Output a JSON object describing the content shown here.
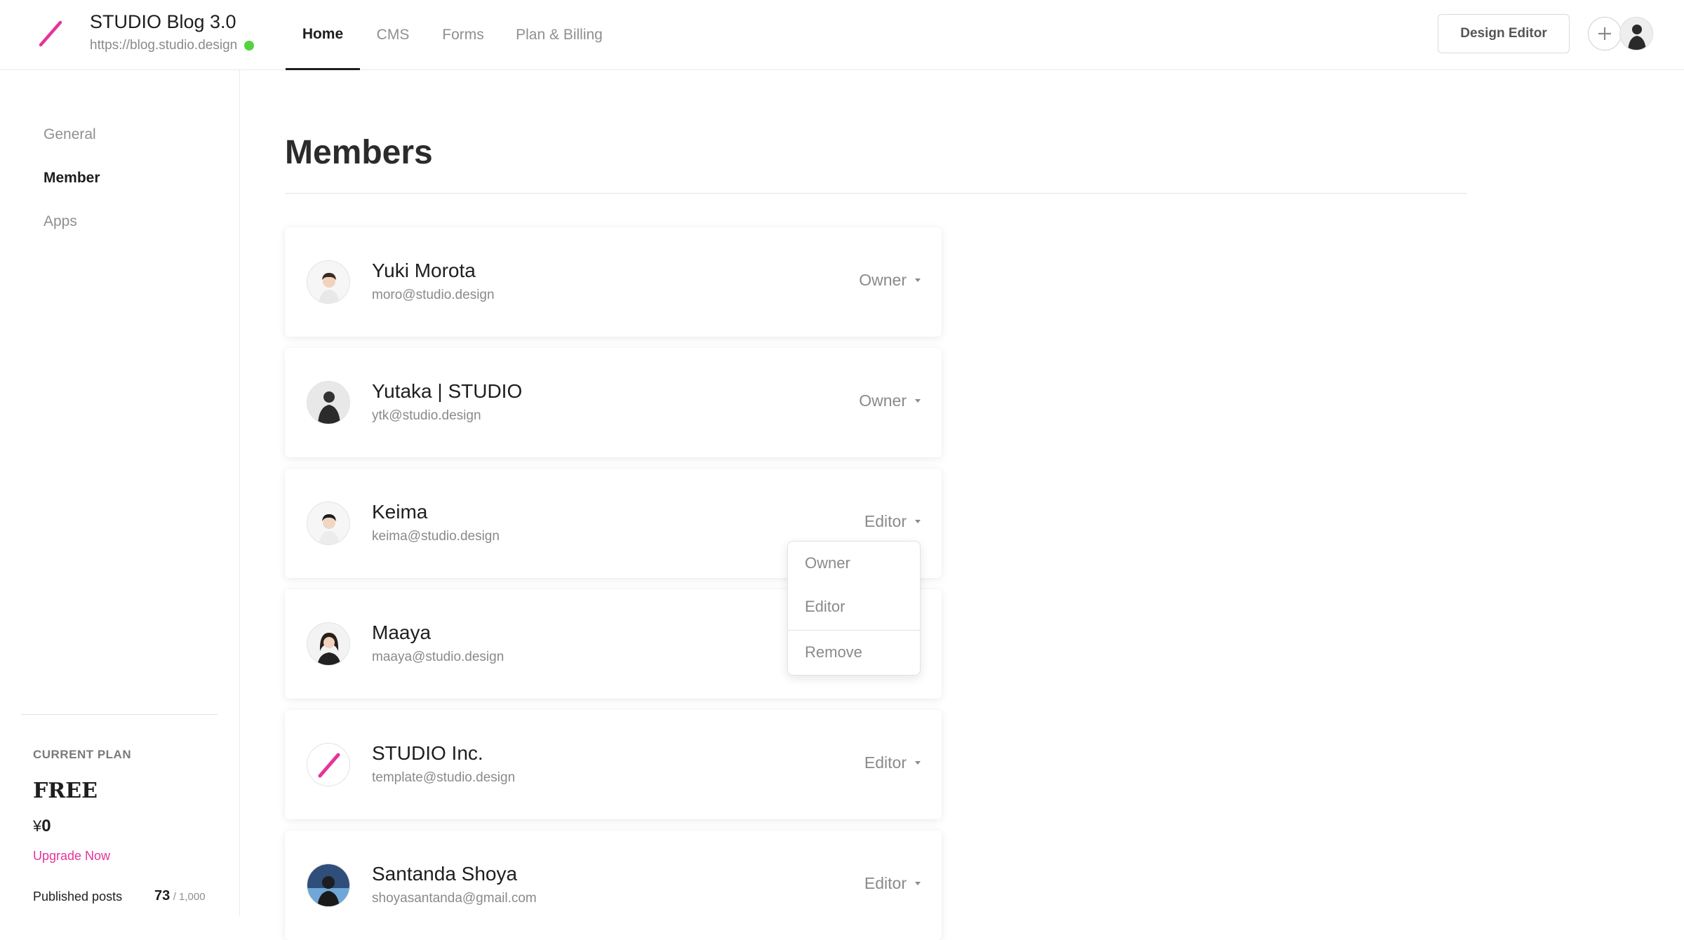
{
  "site": {
    "title": "STUDIO Blog 3.0",
    "url": "https://blog.studio.design",
    "status_color": "#54d33c",
    "brand_color": "#e6339a"
  },
  "nav": {
    "tabs": [
      {
        "label": "Home",
        "active": true
      },
      {
        "label": "CMS",
        "active": false
      },
      {
        "label": "Forms",
        "active": false
      },
      {
        "label": "Plan & Billing",
        "active": false
      }
    ]
  },
  "header": {
    "design_editor_label": "Design Editor",
    "add_icon": "plus-icon"
  },
  "sidebar": {
    "items": [
      {
        "label": "General",
        "active": false
      },
      {
        "label": "Member",
        "active": true
      },
      {
        "label": "Apps",
        "active": false
      }
    ],
    "plan": {
      "label": "CURRENT PLAN",
      "name": "FREE",
      "currency": "¥",
      "price": "0",
      "upgrade_label": "Upgrade Now"
    },
    "posts": {
      "label": "Published posts",
      "count": "73",
      "limit": "/ 1,000"
    }
  },
  "main": {
    "title": "Members",
    "members": [
      {
        "name": "Yuki Morota",
        "email": "moro@studio.design",
        "role": "Owner"
      },
      {
        "name": "Yutaka | STUDIO",
        "email": "ytk@studio.design",
        "role": "Owner"
      },
      {
        "name": "Keima",
        "email": "keima@studio.design",
        "role": "Editor"
      },
      {
        "name": "Maaya",
        "email": "maaya@studio.design",
        "role": ""
      },
      {
        "name": "STUDIO Inc.",
        "email": "template@studio.design",
        "role": "Editor"
      },
      {
        "name": "Santanda Shoya",
        "email": "shoyasantanda@gmail.com",
        "role": "Editor"
      }
    ],
    "dropdown": {
      "options": [
        "Owner",
        "Editor",
        "Remove"
      ]
    }
  }
}
